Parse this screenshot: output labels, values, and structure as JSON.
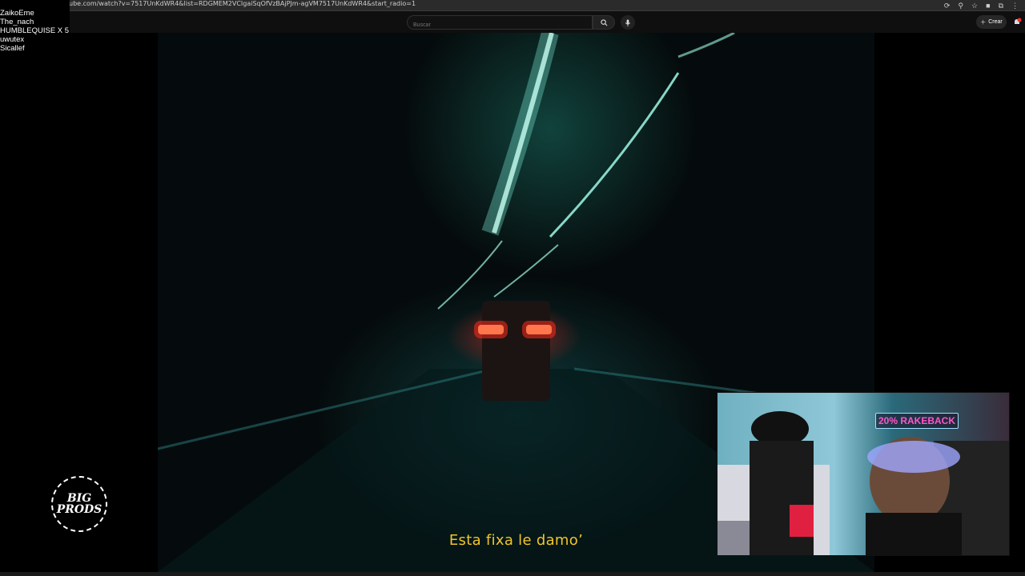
{
  "browser": {
    "url": "ube.com/watch?v=7517UnKdWR4&list=RDGMEM2VCIgaiSqOfVzBAjPJm-agVM7517UnKdWR4&start_radio=1"
  },
  "youtube": {
    "search_placeholder": "Buscar",
    "create_label": "Crear",
    "notification_badge": "9+"
  },
  "overlay": {
    "names": [
      "ZaikoEme",
      "The_nach",
      "HUMBLEQUISE X 5",
      "uwutex",
      "Sicallef"
    ]
  },
  "video": {
    "subtitle": "Esta fixa le damo’"
  },
  "webcam": {
    "neon_sign": "20% RAKEBACK"
  },
  "logo": {
    "line1": "BIG",
    "line2": "PRODS"
  },
  "colors": {
    "subtitle": "#f1c62a",
    "video_bg": "#050b0c",
    "teal_light": "#5fe0c8",
    "tail_light": "#ff2a1a"
  }
}
